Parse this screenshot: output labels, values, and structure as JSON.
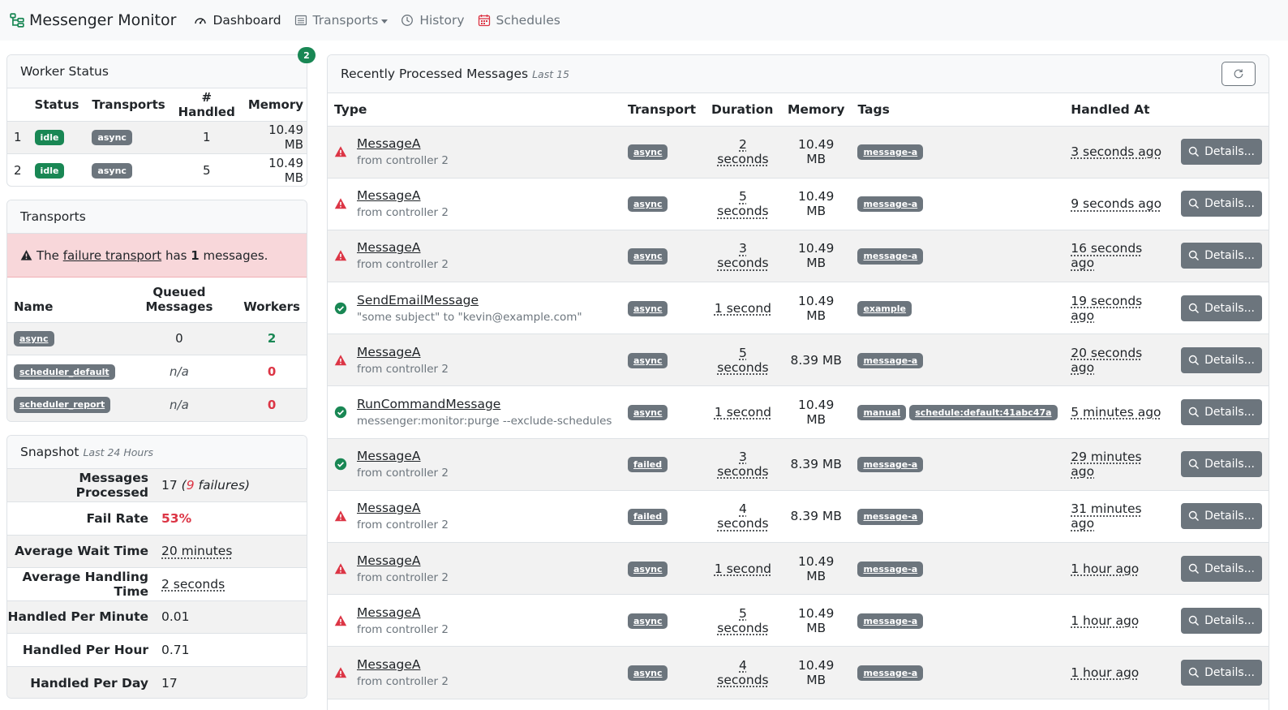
{
  "app": {
    "brand": "Messenger Monitor",
    "nav": [
      {
        "label": "Dashboard",
        "icon": "gauge-icon",
        "active": true
      },
      {
        "label": "Transports",
        "icon": "list-icon",
        "dropdown": true
      },
      {
        "label": "History",
        "icon": "clock-icon"
      },
      {
        "label": "Schedules",
        "icon": "calendar-icon"
      }
    ]
  },
  "worker_status": {
    "title": "Worker Status",
    "count_badge": "2",
    "columns": [
      "",
      "Status",
      "Transports",
      "# Handled",
      "Memory"
    ],
    "rows": [
      {
        "id": "1",
        "status": "idle",
        "transport": "async",
        "handled": "1",
        "memory": "10.49 MB"
      },
      {
        "id": "2",
        "status": "idle",
        "transport": "async",
        "handled": "5",
        "memory": "10.49 MB"
      }
    ]
  },
  "transports": {
    "title": "Transports",
    "alert": {
      "prefix": "The",
      "link": "failure transport",
      "middle": "has",
      "count": "1",
      "suffix": "messages."
    },
    "columns": [
      "Name",
      "Queued Messages",
      "Workers"
    ],
    "rows": [
      {
        "name": "async",
        "queued": "0",
        "workers": "2"
      },
      {
        "name": "scheduler_default",
        "queued": "n/a",
        "workers": "0"
      },
      {
        "name": "scheduler_report",
        "queued": "n/a",
        "workers": "0"
      }
    ]
  },
  "snapshot": {
    "title": "Snapshot",
    "subtitle": "Last 24 Hours",
    "stats": [
      {
        "label": "Messages Processed",
        "value": "17",
        "failures": "9",
        "failures_label": "failures"
      },
      {
        "label": "Fail Rate",
        "value": "53%"
      },
      {
        "label": "Average Wait Time",
        "value": "20 minutes"
      },
      {
        "label": "Average Handling Time",
        "value": "2 seconds"
      },
      {
        "label": "Handled Per Minute",
        "value": "0.01"
      },
      {
        "label": "Handled Per Hour",
        "value": "0.71"
      },
      {
        "label": "Handled Per Day",
        "value": "17"
      }
    ]
  },
  "recent": {
    "title": "Recently Processed Messages",
    "subtitle": "Last 15",
    "refresh_icon": "refresh-icon",
    "columns": [
      "Type",
      "Transport",
      "Duration",
      "Memory",
      "Tags",
      "Handled At",
      ""
    ],
    "details_label": "Details...",
    "status_colors": {
      "failed": "#dc3545",
      "success": "#198754"
    },
    "rows": [
      {
        "status": "failed",
        "type": "MessageA",
        "desc": "from controller 2",
        "transport": "async",
        "duration": "2 seconds",
        "memory": "10.49 MB",
        "tags": [
          "message-a"
        ],
        "handled_at": "3 seconds ago"
      },
      {
        "status": "failed",
        "type": "MessageA",
        "desc": "from controller 2",
        "transport": "async",
        "duration": "5 seconds",
        "memory": "10.49 MB",
        "tags": [
          "message-a"
        ],
        "handled_at": "9 seconds ago"
      },
      {
        "status": "failed",
        "type": "MessageA",
        "desc": "from controller 2",
        "transport": "async",
        "duration": "3 seconds",
        "memory": "10.49 MB",
        "tags": [
          "message-a"
        ],
        "handled_at": "16 seconds ago"
      },
      {
        "status": "success",
        "type": "SendEmailMessage",
        "desc": "\"some subject\" to \"kevin@example.com\"",
        "transport": "async",
        "duration": "1 second",
        "memory": "10.49 MB",
        "tags": [
          "example"
        ],
        "handled_at": "19 seconds ago"
      },
      {
        "status": "failed",
        "type": "MessageA",
        "desc": "from controller 2",
        "transport": "async",
        "duration": "5 seconds",
        "memory": "8.39 MB",
        "tags": [
          "message-a"
        ],
        "handled_at": "20 seconds ago"
      },
      {
        "status": "success",
        "type": "RunCommandMessage",
        "desc": "messenger:monitor:purge --exclude-schedules",
        "transport": "async",
        "duration": "1 second",
        "memory": "10.49 MB",
        "tags": [
          "manual",
          "schedule:default:41abc47a"
        ],
        "handled_at": "5 minutes ago"
      },
      {
        "status": "success",
        "type": "MessageA",
        "desc": "from controller 2",
        "transport": "failed",
        "duration": "3 seconds",
        "memory": "8.39 MB",
        "tags": [
          "message-a"
        ],
        "handled_at": "29 minutes ago"
      },
      {
        "status": "failed",
        "type": "MessageA",
        "desc": "from controller 2",
        "transport": "failed",
        "duration": "4 seconds",
        "memory": "8.39 MB",
        "tags": [
          "message-a"
        ],
        "handled_at": "31 minutes ago"
      },
      {
        "status": "failed",
        "type": "MessageA",
        "desc": "from controller 2",
        "transport": "async",
        "duration": "1 second",
        "memory": "10.49 MB",
        "tags": [
          "message-a"
        ],
        "handled_at": "1 hour ago"
      },
      {
        "status": "failed",
        "type": "MessageA",
        "desc": "from controller 2",
        "transport": "async",
        "duration": "5 seconds",
        "memory": "10.49 MB",
        "tags": [
          "message-a"
        ],
        "handled_at": "1 hour ago"
      },
      {
        "status": "failed",
        "type": "MessageA",
        "desc": "from controller 2",
        "transport": "async",
        "duration": "4 seconds",
        "memory": "10.49 MB",
        "tags": [
          "message-a"
        ],
        "handled_at": "1 hour ago"
      }
    ]
  }
}
